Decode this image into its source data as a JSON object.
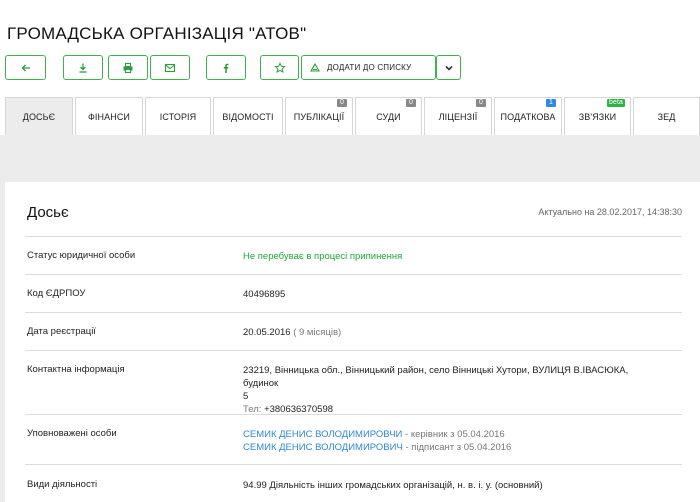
{
  "page": {
    "title": "ГРОМАДСЬКА ОРГАНІЗАЦІЯ \"АТОВ\""
  },
  "toolbar": {
    "buttons": [
      {
        "name": "back",
        "icon": "arrow-left-icon"
      },
      {
        "name": "download",
        "icon": "download-icon"
      },
      {
        "name": "print",
        "icon": "print-icon"
      },
      {
        "name": "email",
        "icon": "mail-icon"
      },
      {
        "name": "facebook",
        "icon": "facebook-icon"
      },
      {
        "name": "favorite",
        "icon": "star-icon"
      }
    ],
    "add_to_list_label": "ДОДАТИ ДО СПИСКУ",
    "accent_color": "#3fb24f"
  },
  "tabs": [
    {
      "label": "ДОСЬЄ",
      "active": true
    },
    {
      "label": "ФІНАНСИ"
    },
    {
      "label": "ІСТОРІЯ"
    },
    {
      "label": "ВІДОМОСТІ"
    },
    {
      "label": "ПУБЛІКАЦІЇ",
      "badge": "0"
    },
    {
      "label": "СУДИ",
      "badge": "0"
    },
    {
      "label": "ЛІЦЕНЗІЇ",
      "badge": "0"
    },
    {
      "label": "ПОДАТКОВА",
      "badge": "1"
    },
    {
      "label": "ЗВ'ЯЗКИ",
      "badge": "beta"
    },
    {
      "label": "ЗЕД"
    }
  ],
  "dossier": {
    "title": "Досьє",
    "actual_date": "Актуально на 28.02.2017, 14:38:30",
    "rows": {
      "status": {
        "label": "Статус юридичної особи",
        "value": "Не перебуває в процесі припинення"
      },
      "edrpou": {
        "label": "Код ЄДРПОУ",
        "value": "40496895"
      },
      "registration": {
        "label": "Дата реєстрації",
        "date": "20.05.2016",
        "age": "( 9 місяців)"
      },
      "contact": {
        "label": "Контактна інформація",
        "address_line1": "23219, Вінницька обл., Вінницький район, село Вінницькі Хутори, ВУЛИЦЯ В.ІВАСЮКА, будинок",
        "address_line2": "5",
        "phone_label": "Тел:",
        "phone": "+380636370598"
      },
      "persons": {
        "label": "Уповноважені особи",
        "person1_name": "СЕМИК ДЕНИС ВОЛОДИМИРОВЧИ",
        "person1_role": " - керівник з 05.04.2016",
        "person2_name": "СЕМИК ДЕНИС ВОЛОДИМИРОВИЧ",
        "person2_role": " - підписант з 05.04.2016"
      },
      "activity": {
        "label": "Види діяльності",
        "value": "94.99 Діяльність інших громадських організацій, н. в. і. у. (основний)"
      }
    }
  }
}
